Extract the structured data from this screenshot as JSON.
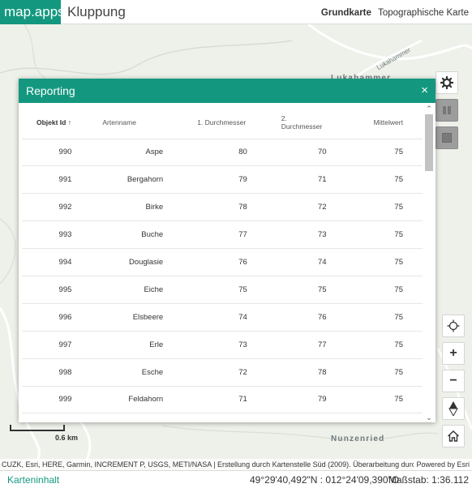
{
  "topbar": {
    "brand": "map.apps",
    "app_title": "Kluppung",
    "basemaps": [
      "Grundkarte",
      "Topographische Karte"
    ]
  },
  "map": {
    "labels": [
      "Lukahammer",
      "Nunzenried",
      "Lukahammer"
    ]
  },
  "dialog": {
    "title": "Reporting",
    "close": "×",
    "columns": [
      "Objekt Id ↑",
      "Artenname",
      "1. Durchmesser",
      "2. Durchmesser",
      "Mittelwert"
    ],
    "rows": [
      {
        "id": "990",
        "name": "Aspe",
        "d1": "80",
        "d2": "70",
        "mean": "75"
      },
      {
        "id": "991",
        "name": "Bergahorn",
        "d1": "79",
        "d2": "71",
        "mean": "75"
      },
      {
        "id": "992",
        "name": "Birke",
        "d1": "78",
        "d2": "72",
        "mean": "75"
      },
      {
        "id": "993",
        "name": "Buche",
        "d1": "77",
        "d2": "73",
        "mean": "75"
      },
      {
        "id": "994",
        "name": "Douglasie",
        "d1": "76",
        "d2": "74",
        "mean": "75"
      },
      {
        "id": "995",
        "name": "Eiche",
        "d1": "75",
        "d2": "75",
        "mean": "75"
      },
      {
        "id": "996",
        "name": "Elsbeere",
        "d1": "74",
        "d2": "76",
        "mean": "75"
      },
      {
        "id": "997",
        "name": "Erle",
        "d1": "73",
        "d2": "77",
        "mean": "75"
      },
      {
        "id": "998",
        "name": "Esche",
        "d1": "72",
        "d2": "78",
        "mean": "75"
      },
      {
        "id": "999",
        "name": "Feldahorn",
        "d1": "71",
        "d2": "79",
        "mean": "75"
      }
    ]
  },
  "scalebar": {
    "label": "0.6 km"
  },
  "attribution": {
    "text": "CUZK, Esri, HERE, Garmin, INCREMENT P, USGS, METI/NASA | Erstellung durch Kartenstelle Süd (2009). Überarbeitung durch FE Gr...",
    "powered": "Powered by Esri"
  },
  "footer": {
    "toc": "Karteninhalt",
    "coords": "49°29'40,492\"N : 012°24'09,390\"O",
    "scale": "Maßstab: 1:36.112"
  },
  "tools": {
    "settings_icon": "gear-icon",
    "locate_icon": "crosshair-icon",
    "zoom_in": "+",
    "zoom_out": "−",
    "compass_icon": "compass-icon",
    "home_icon": "home-icon"
  },
  "colors": {
    "accent": "#13987f"
  }
}
